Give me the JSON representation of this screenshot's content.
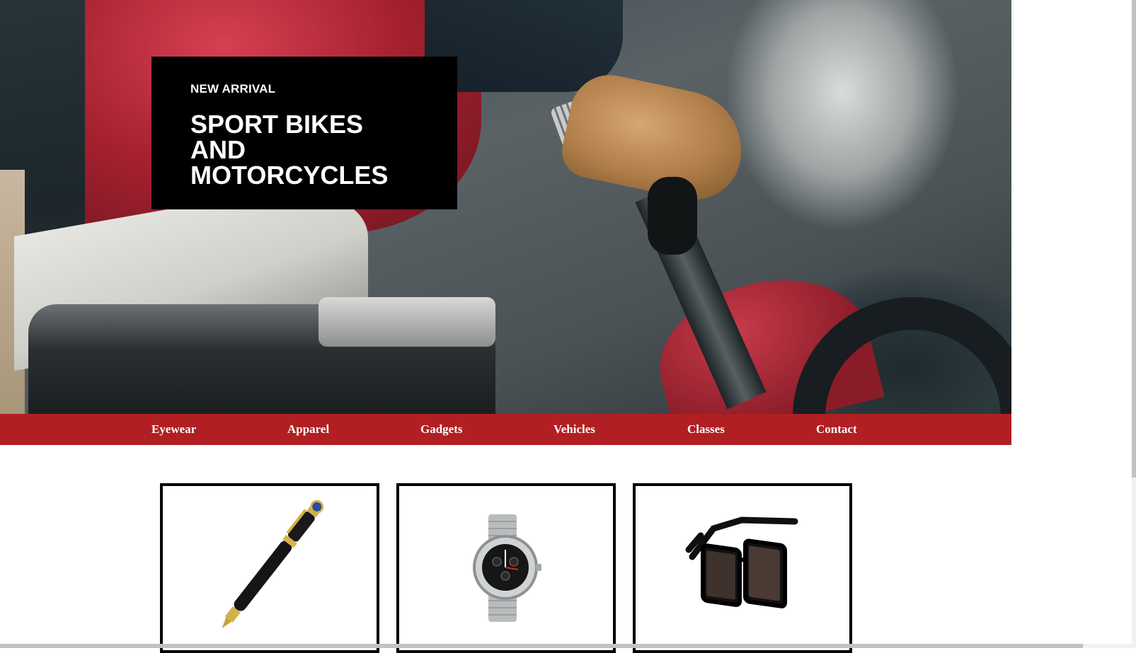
{
  "hero": {
    "eyebrow": "NEW ARRIVAL",
    "title": "SPORT BIKES AND MOTORCYCLES"
  },
  "nav": {
    "items": [
      "Eyewear",
      "Apparel",
      "Gadgets",
      "Vehicles",
      "Classes",
      "Contact"
    ]
  },
  "products": [
    {
      "icon": "pen-icon"
    },
    {
      "icon": "wristwatch-icon"
    },
    {
      "icon": "sunglasses-icon"
    }
  ],
  "colors": {
    "nav_background": "#b11f22",
    "promo_background": "#000000",
    "card_border": "#000000"
  }
}
